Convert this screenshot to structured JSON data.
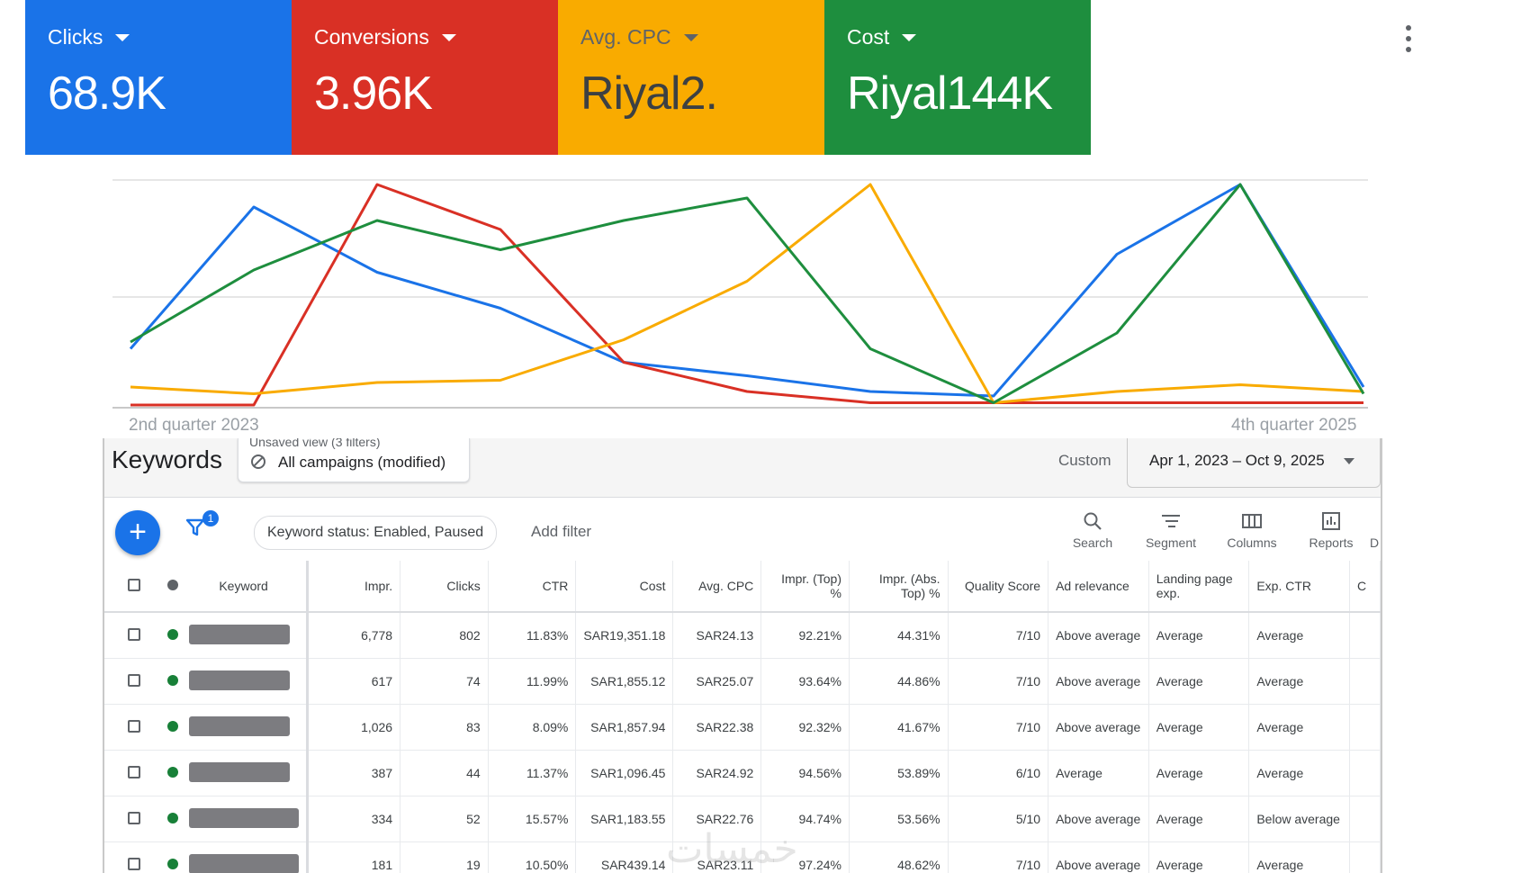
{
  "scorecards": [
    {
      "label": "Clicks",
      "value": "68.9K",
      "color": "#1a73e8"
    },
    {
      "label": "Conversions",
      "value": "3.96K",
      "color": "#d93025"
    },
    {
      "label": "Avg. CPC",
      "value": "Riyal2.",
      "color": "#f9ab00",
      "label_color": "#5f6368",
      "value_color": "#3c4043"
    },
    {
      "label": "Cost",
      "value": "Riyal144K",
      "color": "#1e8e3e"
    }
  ],
  "chart_data": {
    "type": "line",
    "x_start_label": "2nd quarter 2023",
    "x_end_label": "4th quarter 2025",
    "grid": true,
    "series": [
      {
        "color": "#1a73e8",
        "values": [
          0.75,
          0.12,
          0.41,
          0.57,
          0.81,
          0.87,
          0.94,
          0.96,
          0.33,
          0.02,
          0.92
        ]
      },
      {
        "color": "#d93025",
        "values": [
          1.0,
          1.0,
          0.02,
          0.22,
          0.81,
          0.94,
          0.99,
          0.99,
          0.99,
          0.99,
          0.99
        ]
      },
      {
        "color": "#f9ab00",
        "values": [
          0.92,
          0.95,
          0.9,
          0.89,
          0.71,
          0.45,
          0.02,
          0.99,
          0.94,
          0.91,
          0.94
        ]
      },
      {
        "color": "#1e8e3e",
        "values": [
          0.72,
          0.4,
          0.18,
          0.31,
          0.18,
          0.08,
          0.75,
          0.99,
          0.68,
          0.02,
          0.95
        ]
      }
    ]
  },
  "panel": {
    "title": "Keywords",
    "view_subtitle": "Unsaved view (3 filters)",
    "view_label": "All campaigns (modified)",
    "date_mode": "Custom",
    "date_range": "Apr 1, 2023 – Oct 9, 2025"
  },
  "toolbar": {
    "filter_count": "1",
    "chip": "Keyword status: Enabled, Paused",
    "add_filter": "Add filter",
    "tools": [
      "Search",
      "Segment",
      "Columns",
      "Reports",
      "D"
    ]
  },
  "table": {
    "headers": [
      "Keyword",
      "Impr.",
      "Clicks",
      "CTR",
      "Cost",
      "Avg. CPC",
      "Impr. (Top) %",
      "Impr. (Abs. Top) %",
      "Quality Score",
      "Ad relevance",
      "Landing page exp.",
      "Exp. CTR",
      "C"
    ],
    "rows": [
      {
        "status_color": "#188038",
        "impr": "6,778",
        "clicks": "802",
        "ctr": "11.83%",
        "cost": "SAR19,351.18",
        "cpc": "SAR24.13",
        "top": "92.21%",
        "abs_top": "44.31%",
        "qs": "7/10",
        "ad_rel": "Above average",
        "lp": "Average",
        "exp_ctr": "Average"
      },
      {
        "status_color": "#188038",
        "impr": "617",
        "clicks": "74",
        "ctr": "11.99%",
        "cost": "SAR1,855.12",
        "cpc": "SAR25.07",
        "top": "93.64%",
        "abs_top": "44.86%",
        "qs": "7/10",
        "ad_rel": "Above average",
        "lp": "Average",
        "exp_ctr": "Average"
      },
      {
        "status_color": "#188038",
        "impr": "1,026",
        "clicks": "83",
        "ctr": "8.09%",
        "cost": "SAR1,857.94",
        "cpc": "SAR22.38",
        "top": "92.32%",
        "abs_top": "41.67%",
        "qs": "7/10",
        "ad_rel": "Above average",
        "lp": "Average",
        "exp_ctr": "Average"
      },
      {
        "status_color": "#188038",
        "impr": "387",
        "clicks": "44",
        "ctr": "11.37%",
        "cost": "SAR1,096.45",
        "cpc": "SAR24.92",
        "top": "94.56%",
        "abs_top": "53.89%",
        "qs": "6/10",
        "ad_rel": "Average",
        "lp": "Average",
        "exp_ctr": "Average"
      },
      {
        "status_color": "#188038",
        "impr": "334",
        "clicks": "52",
        "ctr": "15.57%",
        "cost": "SAR1,183.55",
        "cpc": "SAR22.76",
        "top": "94.74%",
        "abs_top": "53.56%",
        "qs": "5/10",
        "ad_rel": "Above average",
        "lp": "Average",
        "exp_ctr": "Below average"
      },
      {
        "status_color": "#188038",
        "impr": "181",
        "clicks": "19",
        "ctr": "10.50%",
        "cost": "SAR439.14",
        "cpc": "SAR23.11",
        "top": "97.24%",
        "abs_top": "48.62%",
        "qs": "7/10",
        "ad_rel": "Above average",
        "lp": "Average",
        "exp_ctr": "Average"
      }
    ]
  },
  "watermark": "خمسات"
}
